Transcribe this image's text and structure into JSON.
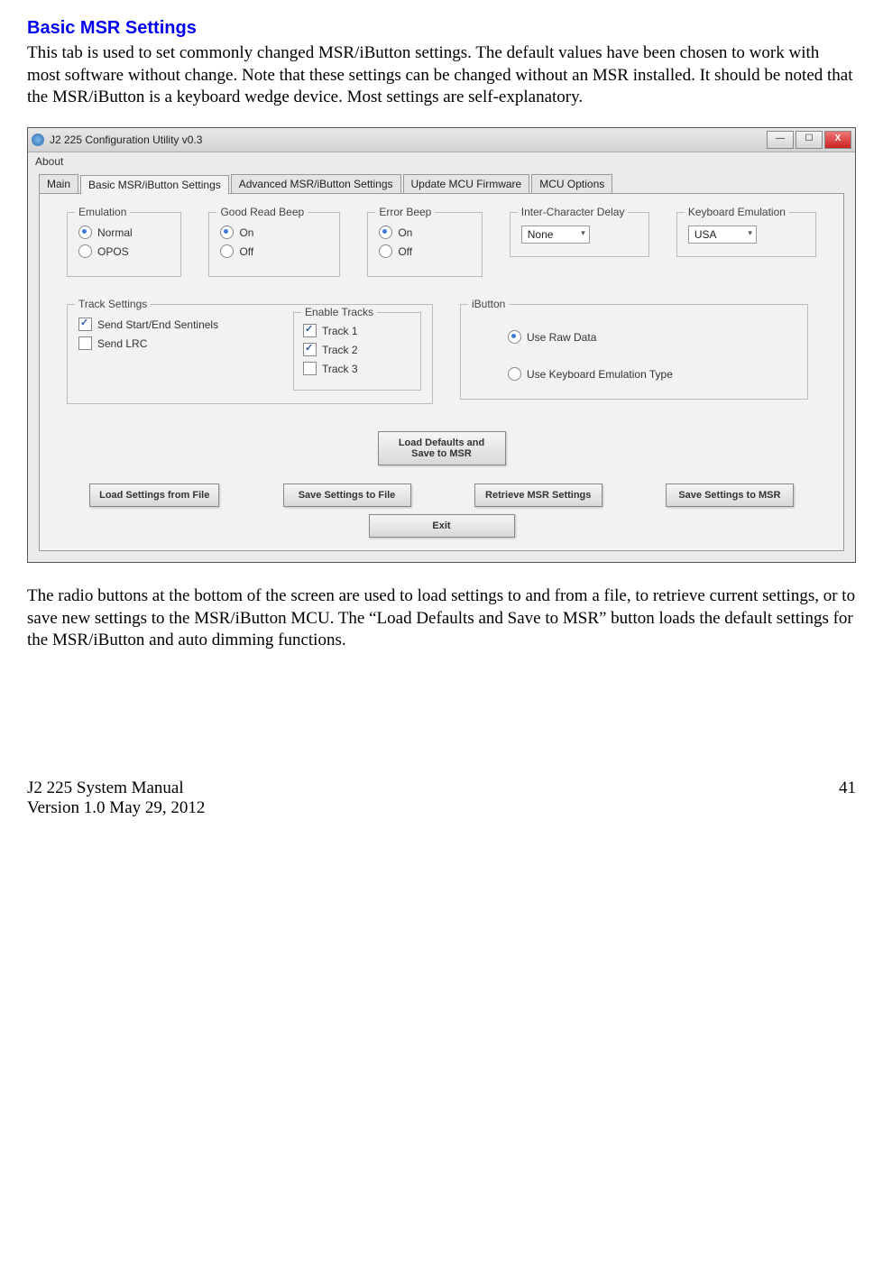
{
  "doc": {
    "heading": "Basic MSR Settings",
    "para1": "This tab is used to set commonly changed MSR/iButton settings. The default values have been chosen to work with most software without change. Note that these settings can be changed without an MSR installed. It should be noted that the MSR/iButton is a keyboard wedge device. Most settings are self-explanatory.",
    "para2": "The radio buttons at the bottom of the screen are used to load settings to and from a file, to retrieve current settings, or to save new settings to the MSR/iButton MCU. The “Load Defaults and Save to MSR” button loads the default settings for the MSR/iButton and auto dimming functions.",
    "footer_left1": "J2 225 System Manual",
    "footer_left2": "Version 1.0 May 29, 2012",
    "page_number": "41"
  },
  "app": {
    "title": "J2 225 Configuration Utility  v0.3",
    "menu_about": "About",
    "tabs": {
      "main": "Main",
      "basic": "Basic MSR/iButton Settings",
      "advanced": "Advanced MSR/iButton Settings",
      "update": "Update MCU Firmware",
      "mcu": "MCU Options"
    },
    "groups": {
      "emulation": {
        "legend": "Emulation",
        "normal": "Normal",
        "opos": "OPOS"
      },
      "good_read": {
        "legend": "Good Read Beep",
        "on": "On",
        "off": "Off"
      },
      "error_beep": {
        "legend": "Error Beep",
        "on": "On",
        "off": "Off"
      },
      "inter_char": {
        "legend": "Inter-Character Delay",
        "value": "None"
      },
      "kbd_emu": {
        "legend": "Keyboard Emulation",
        "value": "USA"
      },
      "track": {
        "legend": "Track Settings",
        "sentinels": "Send Start/End Sentinels",
        "lrc": "Send LRC",
        "enable_legend": "Enable Tracks",
        "t1": "Track 1",
        "t2": "Track 2",
        "t3": "Track 3"
      },
      "ibutton": {
        "legend": "iButton",
        "raw": "Use Raw Data",
        "kbd": "Use Keyboard Emulation Type"
      }
    },
    "buttons": {
      "load_defaults": "Load Defaults and Save to MSR",
      "load_file": "Load Settings from File",
      "save_file": "Save Settings to File",
      "retrieve": "Retrieve MSR Settings",
      "save_msr": "Save Settings to MSR",
      "exit": "Exit"
    }
  }
}
